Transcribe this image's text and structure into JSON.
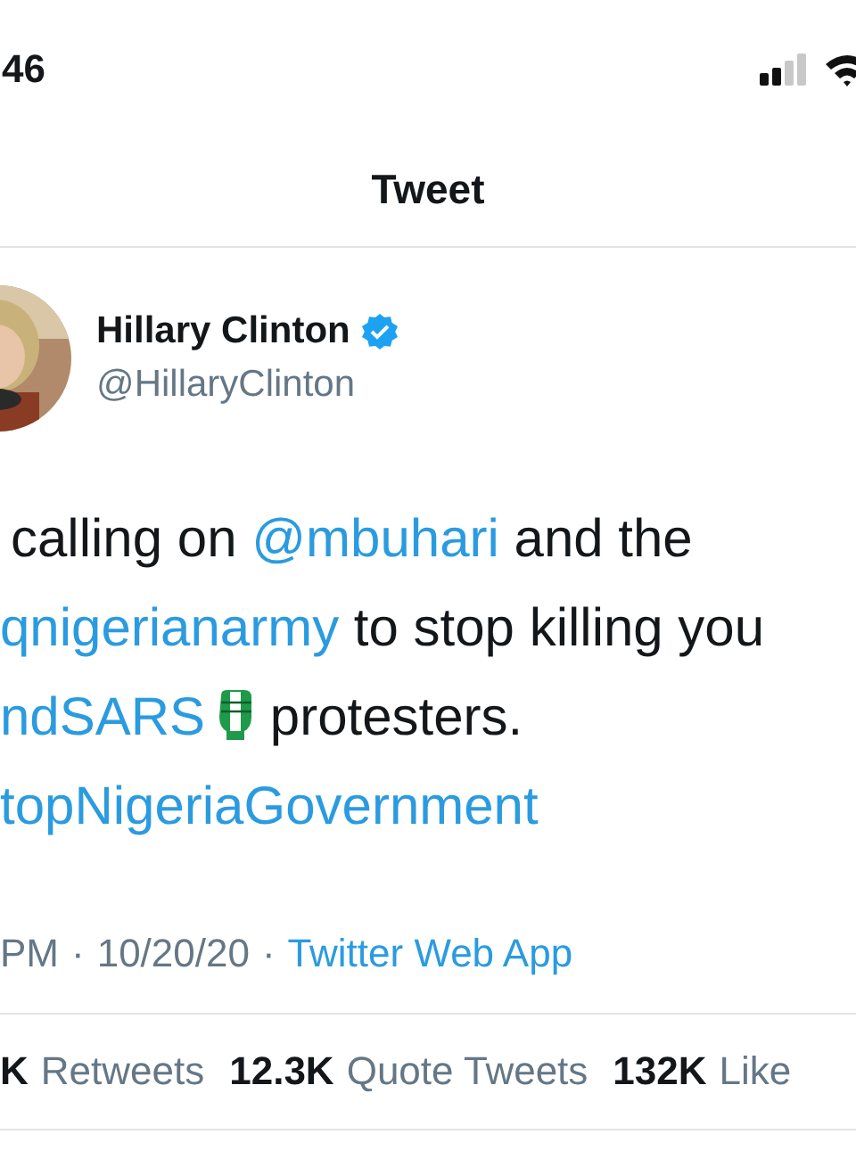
{
  "status_bar": {
    "time": "46"
  },
  "header": {
    "title": "Tweet"
  },
  "author": {
    "name": "Hillary Clinton",
    "verified": true,
    "handle": "@HillaryClinton"
  },
  "tweet": {
    "lines": [
      [
        {
          "kind": "text",
          "text": "calling on "
        },
        {
          "kind": "mention",
          "text": "@mbuhari"
        },
        {
          "kind": "text",
          "text": " and the"
        }
      ],
      [
        {
          "kind": "mention",
          "text": "qnigerianarmy"
        },
        {
          "kind": "text",
          "text": " to stop killing you"
        }
      ],
      [
        {
          "kind": "hashtag",
          "text": "ndSARS"
        },
        {
          "kind": "emoji"
        },
        {
          "kind": "text",
          "text": " protesters."
        }
      ],
      [
        {
          "kind": "hashtag",
          "text": "topNigeriaGovernment"
        }
      ]
    ]
  },
  "meta": {
    "time": "PM",
    "separator": "·",
    "date": "10/20/20",
    "source": "Twitter Web App"
  },
  "stats": [
    {
      "count": "K",
      "label": "Retweets"
    },
    {
      "count": "12.3K",
      "label": "Quote Tweets"
    },
    {
      "count": "132K",
      "label": "Like"
    }
  ]
}
